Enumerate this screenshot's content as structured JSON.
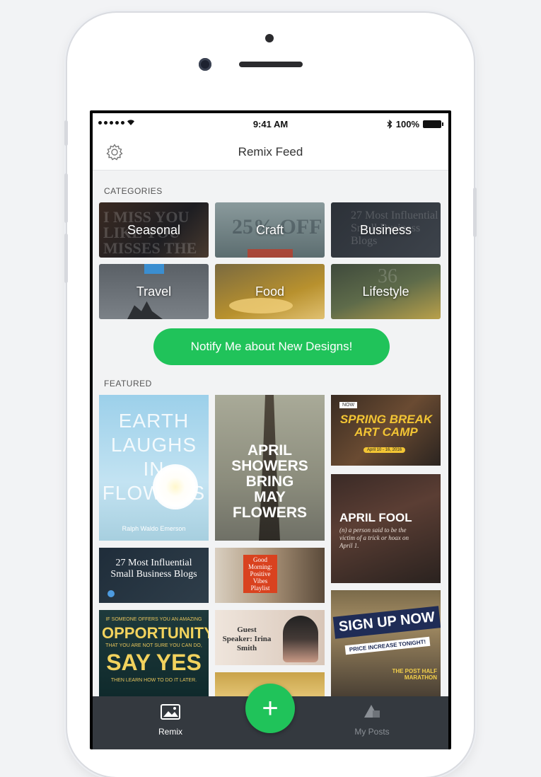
{
  "status": {
    "time": "9:41 AM",
    "battery": "100%"
  },
  "nav": {
    "title": "Remix Feed"
  },
  "sections": {
    "categories": "CATEGORIES",
    "featured": "FEATURED"
  },
  "categories": [
    {
      "label": "Seasonal"
    },
    {
      "label": "Craft"
    },
    {
      "label": "Business"
    },
    {
      "label": "Travel"
    },
    {
      "label": "Food"
    },
    {
      "label": "Lifestyle"
    }
  ],
  "notify_label": "Notify Me about New Designs!",
  "featured": {
    "earth": {
      "line1": "EARTH",
      "line2": "LAUGHS",
      "line3": "IN",
      "line4": "FLOWERS",
      "credit": "Ralph Waldo Emerson"
    },
    "april_showers": {
      "line1": "APRIL",
      "line2": "SHOWERS",
      "line3": "BRING",
      "line4": "MAY",
      "line5": "FLOWERS"
    },
    "spring_break": {
      "badge": "NOW",
      "title": "SPRING BREAK ART CAMP",
      "dates": "April 10 - 16, 2016"
    },
    "april_fool": {
      "title": "APRIL FOOL",
      "sub": "(n) a person said to be the victim of a trick or hoax on April 1."
    },
    "blogs": {
      "title": "27 Most Influential Small Business Blogs"
    },
    "morning": {
      "text": "Good Morning: Positive Vibes Playlist"
    },
    "opportunity": {
      "line1": "IF SOMEONE OFFERS YOU AN AMAZING",
      "line2": "OPPORTUNITY",
      "line3": "THAT YOU ARE NOT SURE YOU CAN DO,",
      "line4": "SAY YES",
      "line5": "THEN LEARN HOW TO DO IT LATER."
    },
    "speaker": {
      "text": "Guest Speaker: Irina Smith"
    },
    "signup": {
      "title": "SIGN UP NOW",
      "sub": "PRICE INCREASE TONIGHT!",
      "foot": "THE POST HALF MARATHON"
    }
  },
  "tabs": {
    "remix": "Remix",
    "my_posts": "My Posts"
  },
  "fab": "+"
}
